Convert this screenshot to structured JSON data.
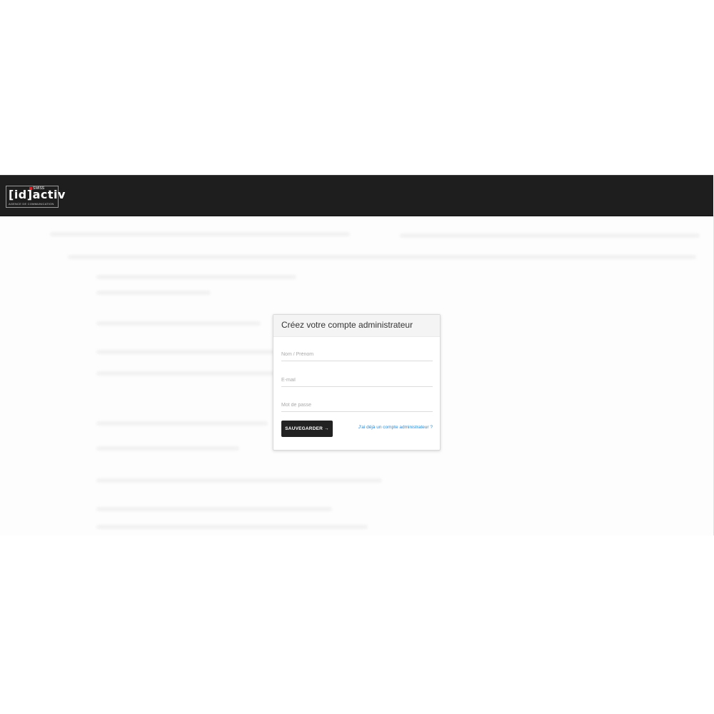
{
  "header": {
    "logo": {
      "main_text": "[id]activ",
      "swiss_text": "SWISS",
      "sub_text": "AGENCE DE COMMUNICATION"
    }
  },
  "form": {
    "title": "Créez votre compte administrateur",
    "fields": {
      "name_placeholder": "Nom / Prénom",
      "email_placeholder": "E-mail",
      "password_placeholder": "Mot de passe"
    },
    "save_label": "SAUVEGARDER →",
    "login_link": "J'ai déjà un compte administrateur ?"
  },
  "colors": {
    "topbar": "#1e1e1e",
    "button": "#222222",
    "link": "#2a8ad6",
    "logo_accent": "#d8262e"
  }
}
